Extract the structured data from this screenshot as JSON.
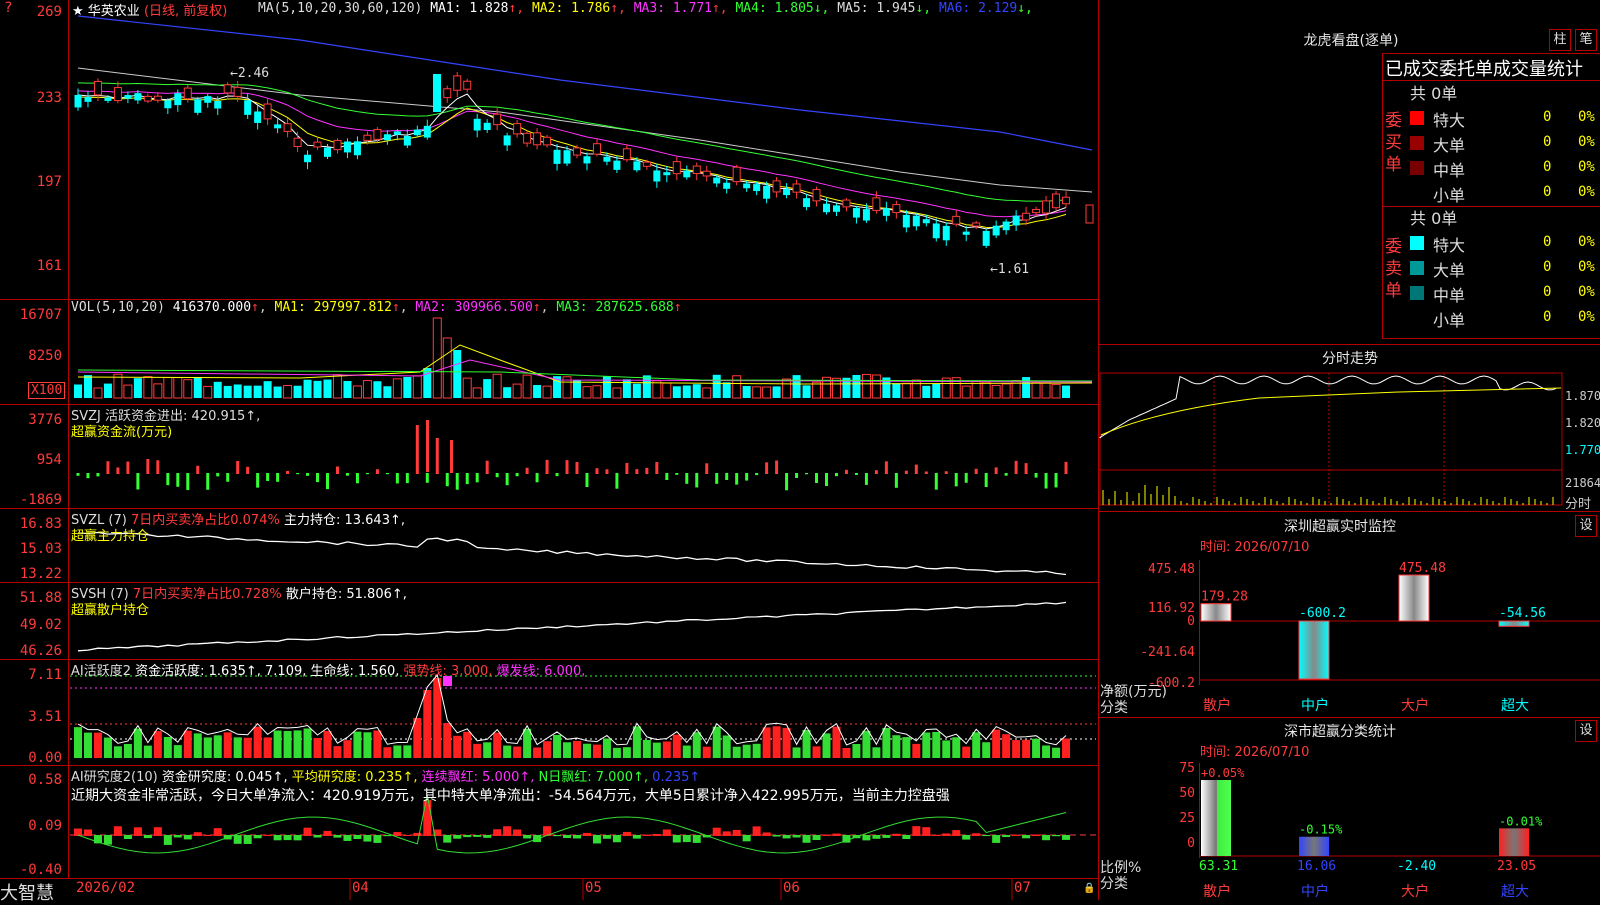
{
  "stock": {
    "name": "华英农业",
    "mode": "(日线, 前复权)",
    "ma_header": "MA(5,10,20,30,60,120)",
    "ma": [
      {
        "label": "MA1:",
        "value": "1.828",
        "arrow": "↑",
        "color": "#ffffff"
      },
      {
        "label": "MA2:",
        "value": "1.786",
        "arrow": "↑",
        "color": "#ffff00"
      },
      {
        "label": "MA3:",
        "value": "1.771",
        "arrow": "↑",
        "color": "#ff33ff"
      },
      {
        "label": "MA4:",
        "value": "1.805",
        "arrow": "↓",
        "color": "#33ff33"
      },
      {
        "label": "MA5:",
        "value": "1.945",
        "arrow": "↓",
        "color": "#dddddd"
      },
      {
        "label": "MA6:",
        "value": "2.129",
        "arrow": "↓",
        "color": "#3344ff"
      }
    ],
    "y_ticks": [
      "269",
      "233",
      "197",
      "161"
    ],
    "high_mark": "←2.46",
    "low_mark": "←1.61"
  },
  "vol": {
    "header": "VOL(5,10,20)",
    "value": "416370.000",
    "ma1": "297997.812",
    "ma2": "309966.500",
    "ma3": "287625.688",
    "y_ticks": [
      "16707",
      "8250"
    ],
    "unit": "X100"
  },
  "svzj": {
    "title": "SVZJ  活跃资金进出: 420.915↑,",
    "subtitle": "超赢资金流(万元)",
    "y_ticks": [
      "3776",
      "954",
      "-1869"
    ]
  },
  "svzl": {
    "name": "SVZL (7)",
    "ratio": "7日内买卖净占比0.074%",
    "hold": "主力持仓: 13.643↑,",
    "subtitle": "超赢主力持仓",
    "y_ticks": [
      "16.83",
      "15.03",
      "13.22"
    ]
  },
  "svsh": {
    "name": "SVSH (7)",
    "ratio": "7日内买卖净占比0.728%",
    "hold": "散户持仓: 51.806↑,",
    "subtitle": "超赢散户持仓",
    "y_ticks": [
      "51.88",
      "49.02",
      "46.26"
    ]
  },
  "ai_act": {
    "name": "AI活跃度2",
    "fund": "资金活跃度: 1.635↑, 7.109,",
    "life": "生命线: 1.560,",
    "strong": "强势线: 3.000,",
    "burst": "爆发线: 6.000,",
    "y_ticks": [
      "7.11",
      "3.51",
      "0.00"
    ]
  },
  "ai_res": {
    "name": "AI研究度2(10)",
    "fund": "资金研究度: 0.045↑,",
    "avg": "平均研究度: 0.235↑,",
    "cont": "连续飘红: 5.000↑,",
    "nday": "N日飘红: 7.000↑,",
    "last": "0.235↑",
    "comment": "近期大资金非常活跃，今日大单净流入：420.919万元，其中特大单净流出：-54.564万元，大单5日累计净入422.995万元，当前主力控盘强",
    "y_ticks": [
      "0.58",
      "0.09",
      "-0.40"
    ]
  },
  "x_axis": [
    "2026/02",
    "04",
    "05",
    "06",
    "07"
  ],
  "brand": "大智慧",
  "dragon": {
    "title": "龙虎看盘(逐单)",
    "btn_bar": "柱",
    "btn_pen": "笔",
    "header": "已成交委托单成交量统计",
    "buy_label": "委买单",
    "sell_label": "委卖单",
    "buy_total": "共 0单",
    "sell_total": "共 0单",
    "buy_rows": [
      {
        "name": "特大",
        "count": "0",
        "pct": "0%",
        "color": "#ff0000"
      },
      {
        "name": "大单",
        "count": "0",
        "pct": "0%",
        "color": "#990000"
      },
      {
        "name": "中单",
        "count": "0",
        "pct": "0%",
        "color": "#770000"
      },
      {
        "name": "小单",
        "count": "0",
        "pct": "0%",
        "color": "#000000"
      }
    ],
    "sell_rows": [
      {
        "name": "特大",
        "count": "0",
        "pct": "0%",
        "color": "#00ffff"
      },
      {
        "name": "大单",
        "count": "0",
        "pct": "0%",
        "color": "#009999"
      },
      {
        "name": "中单",
        "count": "0",
        "pct": "0%",
        "color": "#007777"
      },
      {
        "name": "小单",
        "count": "0",
        "pct": "0%",
        "color": "#000000"
      }
    ]
  },
  "intraday": {
    "title": "分时走势",
    "price_ticks": [
      "1.870",
      "1.820",
      "1.770"
    ],
    "vol_tick": "21864",
    "footer": "分时"
  },
  "sz_monitor": {
    "title": "深圳超赢实时监控",
    "set": "设",
    "time": "时间: 2026/07/10",
    "y_ticks": [
      "475.48",
      "116.92",
      "0",
      "-241.64",
      "-600.2"
    ],
    "bars": [
      {
        "cat": "散户",
        "value": "179.28"
      },
      {
        "cat": "中户",
        "value": "-600.2"
      },
      {
        "cat": "大户",
        "value": "475.48"
      },
      {
        "cat": "超大",
        "value": "-54.56"
      }
    ],
    "unit_label": "净额(万元)",
    "class_label": "分类"
  },
  "sz_class": {
    "title": "深市超赢分类统计",
    "set": "设",
    "time": "时间: 2026/07/10",
    "y_ticks": [
      "75",
      "50",
      "25",
      "0"
    ],
    "bars": [
      {
        "cat": "散户",
        "pct": "+0.05%",
        "value": "63.31"
      },
      {
        "cat": "中户",
        "pct": "-0.15%",
        "value": "16.06"
      },
      {
        "cat": "大户",
        "pct": "",
        "value": "-2.40"
      },
      {
        "cat": "超大",
        "pct": "-0.01%",
        "value": "23.05"
      }
    ],
    "ratio_label": "比例%",
    "class_label": "分类"
  }
}
